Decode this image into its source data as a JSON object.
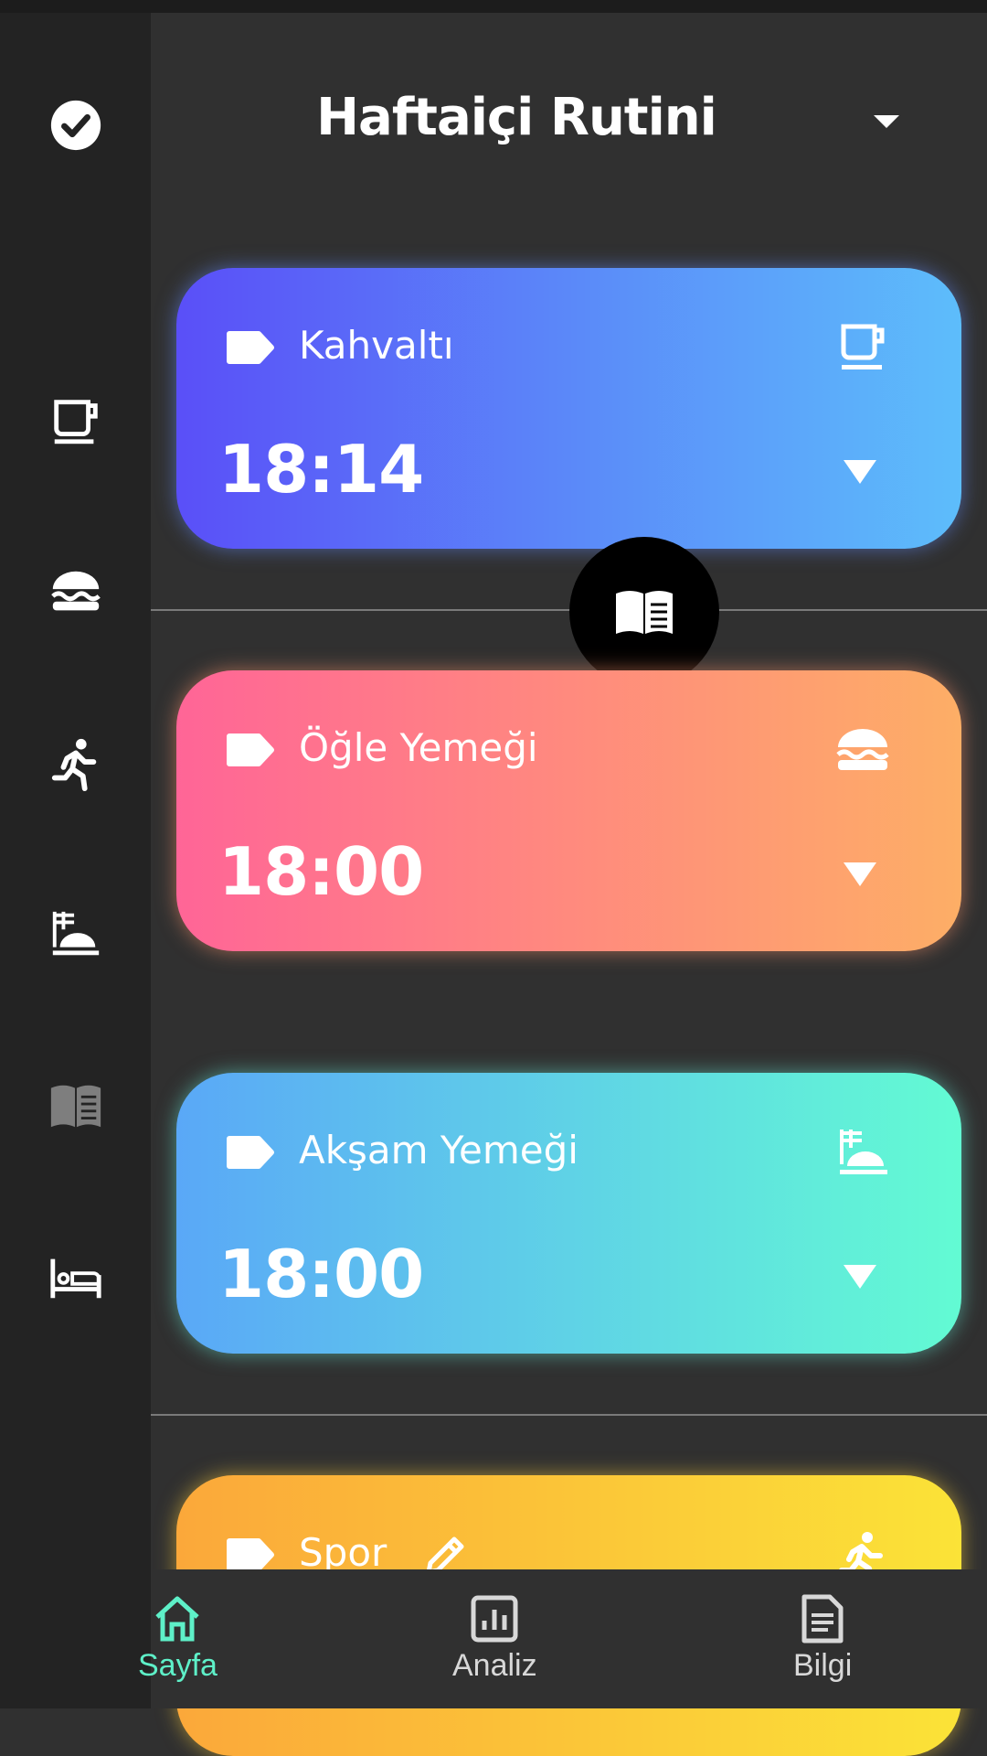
{
  "header": {
    "title": "Haftaiçi Rutini"
  },
  "sidebar": {
    "icons": [
      "check-circle-icon",
      "coffee-icon",
      "burger-icon",
      "running-icon",
      "dinner-tray-icon",
      "book-icon",
      "bed-icon"
    ]
  },
  "cards": [
    {
      "label": "Kahvaltı",
      "time": "18:14",
      "icon": "coffee-icon"
    },
    {
      "label": "Öğle Yemeği",
      "time": "18:00",
      "icon": "burger-icon"
    },
    {
      "label": "Akşam Yemeği",
      "time": "18:00",
      "icon": "dinner-tray-icon"
    },
    {
      "label": "Spor",
      "icon": "running-icon"
    }
  ],
  "fab": {
    "icon": "book-open-icon"
  },
  "bottom_nav": {
    "items": [
      {
        "label": "Sayfa",
        "icon": "home-icon",
        "active": true
      },
      {
        "label": "Analiz",
        "icon": "chart-icon",
        "active": false
      },
      {
        "label": "Bilgi",
        "icon": "document-icon",
        "active": false
      }
    ]
  },
  "colors": {
    "background": "#303030",
    "sidebar": "#232323",
    "active_nav": "#5ef0c8",
    "inactive_nav": "#d8d8d8"
  }
}
